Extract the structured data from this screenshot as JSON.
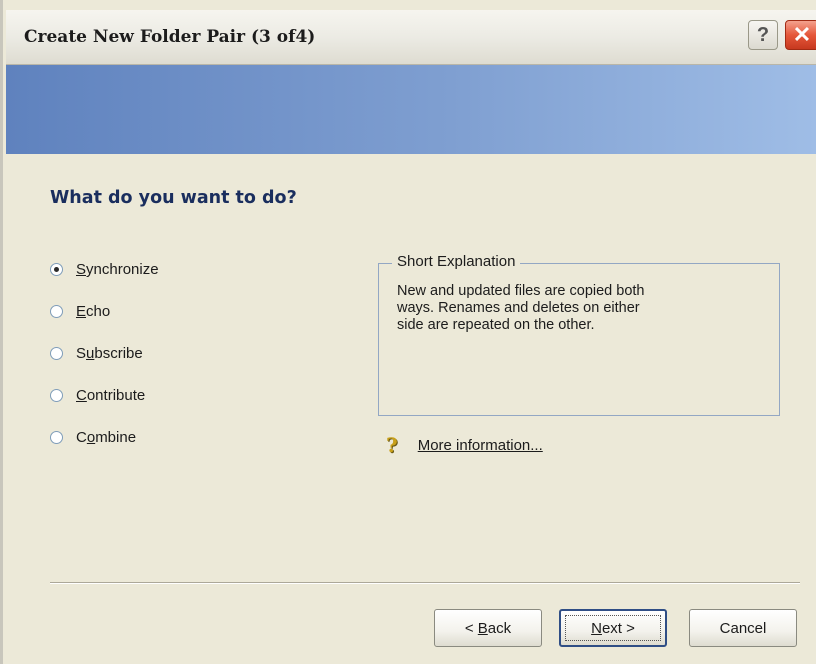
{
  "window": {
    "title": "Create New Folder Pair (3 of4)",
    "help_glyph": "?",
    "close_glyph": "✕",
    "banner_colors": [
      "#5f82be",
      "#9fbde6"
    ]
  },
  "page": {
    "heading": "What do you want to do?"
  },
  "options": [
    {
      "pre": "",
      "mnemonic": "S",
      "post": "ynchronize",
      "checked": true
    },
    {
      "pre": "",
      "mnemonic": "E",
      "post": "cho",
      "checked": false
    },
    {
      "pre": "S",
      "mnemonic": "u",
      "post": "bscribe",
      "checked": false
    },
    {
      "pre": "",
      "mnemonic": "C",
      "post": "ontribute",
      "checked": false
    },
    {
      "pre": "C",
      "mnemonic": "o",
      "post": "mbine",
      "checked": false
    }
  ],
  "explanation": {
    "legend": "Short Explanation",
    "line1": "New and updated files are copied both",
    "line2": "ways. Renames and deletes on either",
    "line3": "side are repeated on the other."
  },
  "more_info": {
    "icon": "lightbulb-icon",
    "glyph": "?",
    "label": "More information..."
  },
  "buttons": {
    "back_pre": "< ",
    "back_mnemonic": "B",
    "back_post": "ack",
    "next_mnemonic": "N",
    "next_post": "ext >",
    "cancel": "Cancel"
  }
}
